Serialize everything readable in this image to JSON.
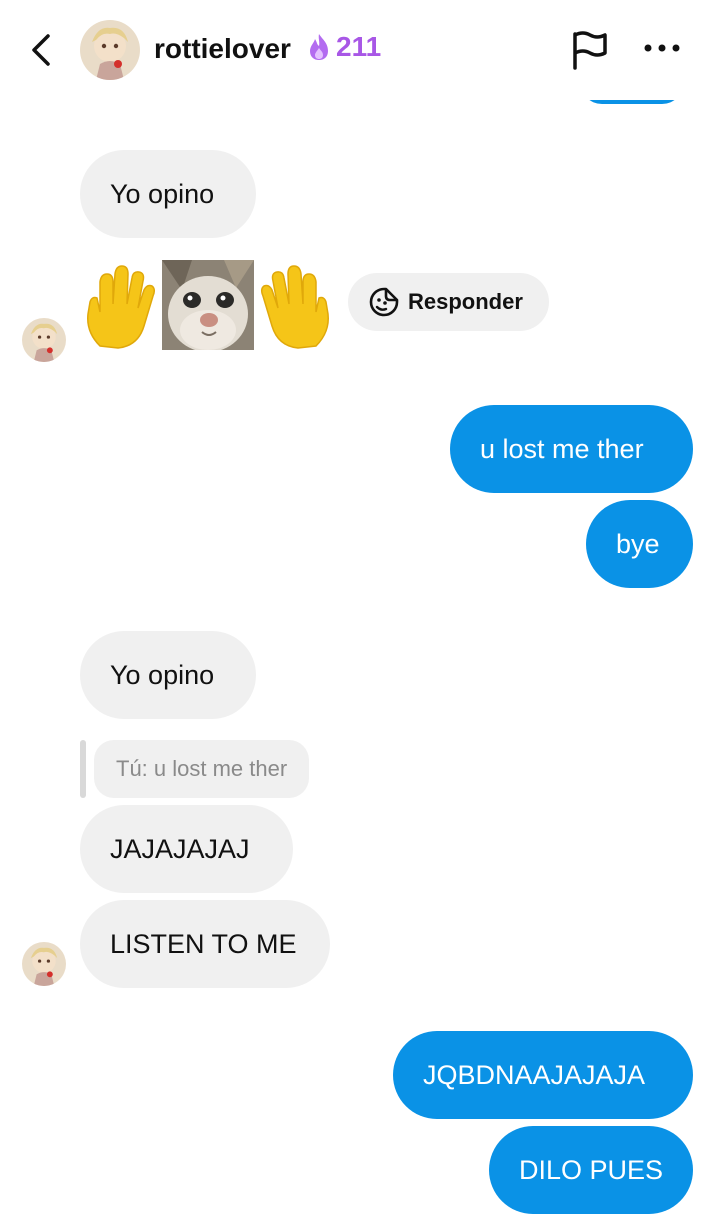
{
  "header": {
    "username": "rottielover",
    "streak_count": "211",
    "icons": {
      "back": "chevron-left-icon",
      "streak": "flame-icon",
      "flag": "flag-icon",
      "more": "more-icon"
    }
  },
  "colors": {
    "outgoing_bubble": "#0a92e6",
    "incoming_bubble": "#f0f0f0",
    "streak": "#a857e6"
  },
  "messages": {
    "m1": "Yo opino",
    "reply_button": "Responder",
    "m2": "u lost me ther",
    "m3": "bye",
    "m4": "Yo opino",
    "reply_quote": "Tú: u lost me ther",
    "m5": "JAJAJAJAJ",
    "m6": "LISTEN TO ME",
    "m7": "JQBDNAAJAJAJA",
    "m8": "DILO PUES"
  }
}
